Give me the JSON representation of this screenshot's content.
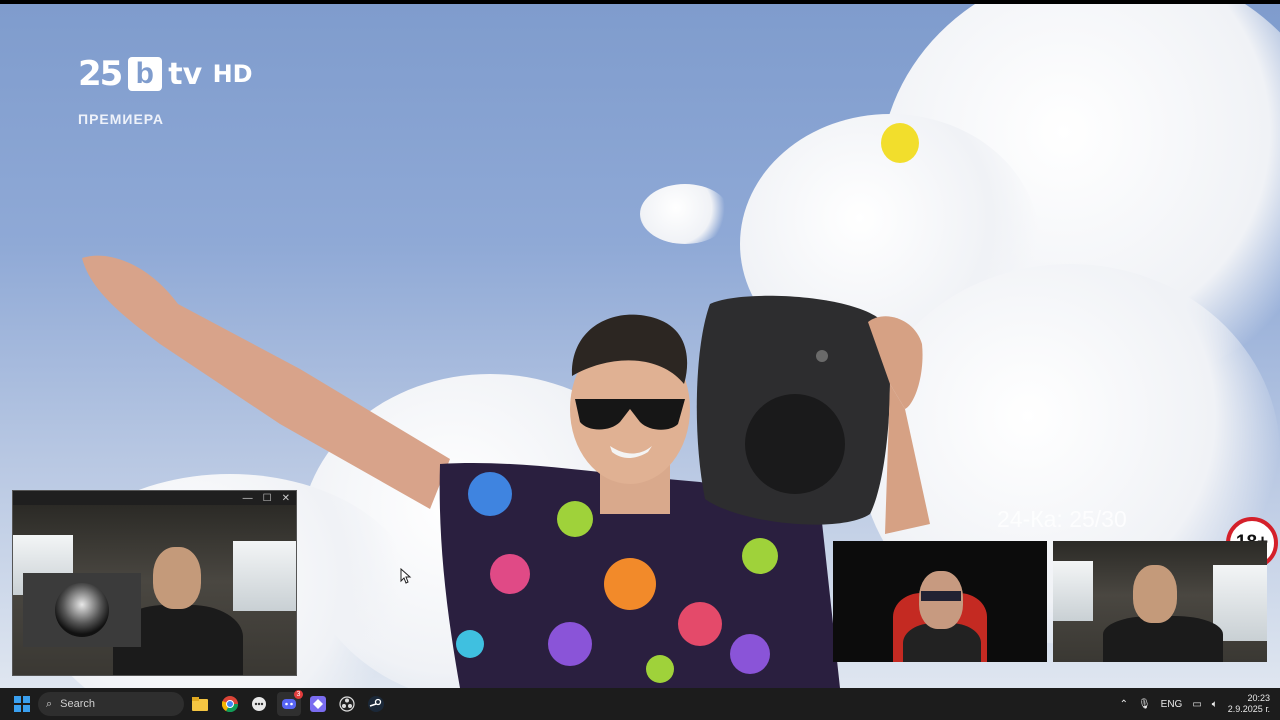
{
  "overlay": {
    "logo_number": "25",
    "logo_b": "b",
    "logo_tv": "tv",
    "logo_hd": "HD",
    "premiere_label": "ПРЕМИЕРА",
    "episode_text": "24-Ка: 25/30",
    "age_rating": "18+"
  },
  "taskbar": {
    "search_placeholder": "Search",
    "language": "ENG",
    "time": "20:23",
    "date": "2.9.2025 г.",
    "discord_badge": "3"
  },
  "colors": {
    "sky": "#8fa9d6",
    "rating_border": "#d4202a",
    "taskbar": "#1c1c1c"
  }
}
